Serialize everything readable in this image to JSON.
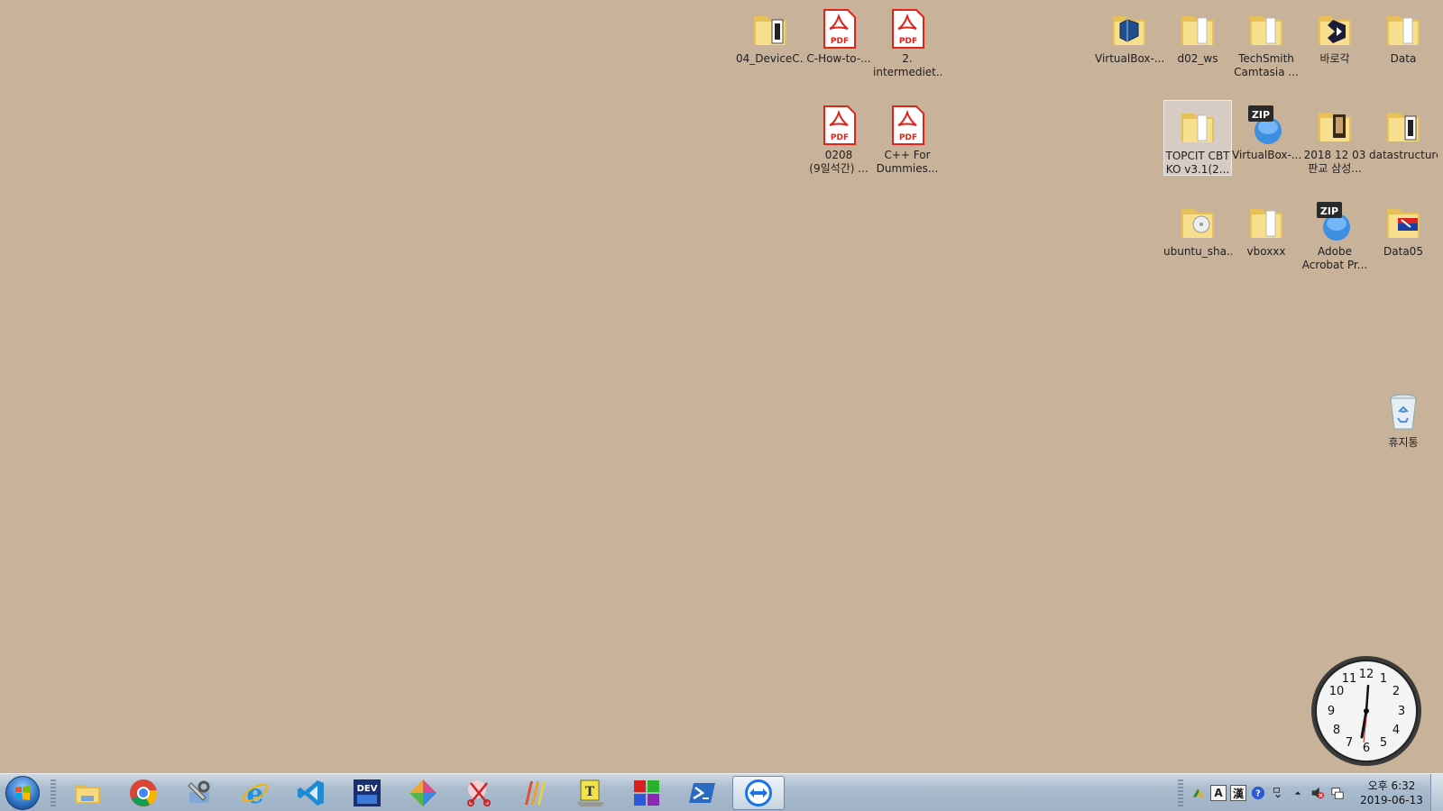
{
  "desktop": {
    "icons": [
      {
        "label": "04_DeviceC...",
        "kind": "folder-doc"
      },
      {
        "label": "C-How-to-...",
        "kind": "pdf"
      },
      {
        "label": "2.\nintermediet...",
        "kind": "pdf"
      },
      {
        "label": "0208\n(9일석간) ...",
        "kind": "pdf"
      },
      {
        "label": "C++ For\nDummies...",
        "kind": "pdf"
      },
      {
        "label": "VirtualBox-...",
        "kind": "folder-vbox"
      },
      {
        "label": "d02_ws",
        "kind": "folder"
      },
      {
        "label": "TechSmith\nCamtasia ...",
        "kind": "folder"
      },
      {
        "label": "바로각",
        "kind": "folder-vs"
      },
      {
        "label": "Data",
        "kind": "folder"
      },
      {
        "label": "TOPCIT CBT\nKO v3.1(2...",
        "kind": "folder",
        "selected": true
      },
      {
        "label": "VirtualBox-...",
        "kind": "zip"
      },
      {
        "label": "2018 12 03\n판교 삼성...",
        "kind": "folder-media"
      },
      {
        "label": "datastructure",
        "kind": "folder-doc"
      },
      {
        "label": "ubuntu_sha...",
        "kind": "folder-disc"
      },
      {
        "label": "vboxxx",
        "kind": "folder"
      },
      {
        "label": "Adobe\nAcrobat Pr...",
        "kind": "zip"
      },
      {
        "label": "Data05",
        "kind": "folder-flag"
      },
      {
        "label": "휴지통",
        "kind": "recycle-bin"
      }
    ],
    "zip_badge": "ZIP",
    "pdf_badge": "PDF"
  },
  "clock_gadget": {
    "numbers": [
      "12",
      "1",
      "2",
      "3",
      "4",
      "5",
      "6",
      "7",
      "8",
      "9",
      "10",
      "11"
    ],
    "time": "6:32"
  },
  "taskbar": {
    "pinned": [
      {
        "name": "windows-explorer",
        "icon": "folder-icon"
      },
      {
        "name": "chrome",
        "icon": "chrome-icon"
      },
      {
        "name": "tools",
        "icon": "wrench-icon"
      },
      {
        "name": "internet-explorer",
        "icon": "ie-icon"
      },
      {
        "name": "vscode",
        "icon": "vscode-icon"
      },
      {
        "name": "dev-cpp",
        "icon": "devcpp-icon",
        "text": "DEV"
      },
      {
        "name": "paint-app",
        "icon": "diamond-icon"
      },
      {
        "name": "snipping-tool",
        "icon": "scissors-icon"
      },
      {
        "name": "sublime-like",
        "icon": "stripes-icon"
      },
      {
        "name": "notepad-t",
        "icon": "laptop-icon",
        "text": "T"
      },
      {
        "name": "winrar-like",
        "icon": "blocks-icon"
      },
      {
        "name": "powershell",
        "icon": "powershell-icon"
      },
      {
        "name": "teamviewer",
        "icon": "teamviewer-icon",
        "active": true
      }
    ],
    "tray": {
      "ime_a": "A",
      "ime_han": "漢",
      "time": "오후 6:32",
      "date": "2019-06-13"
    }
  },
  "colors": {
    "desktop_bg": "#c9b29a",
    "folder": "#f2d57a",
    "pdf_red": "#e0241b",
    "taskbar": "#a9bbcd"
  }
}
